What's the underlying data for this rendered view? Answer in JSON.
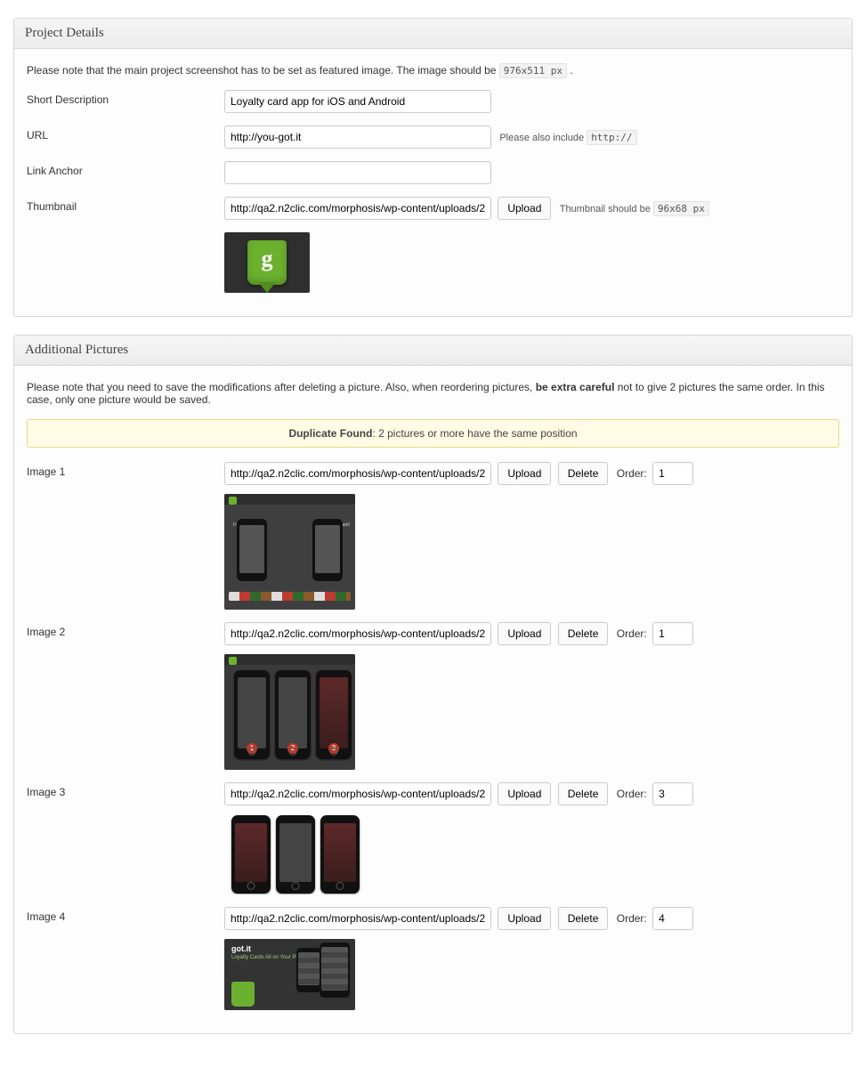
{
  "panels": {
    "project_details": {
      "title": "Project Details",
      "note_pre": "Please note that the main project screenshot has to be set as featured image. The image should be ",
      "note_code": "976x511 px",
      "note_post": " .",
      "fields": {
        "short_desc": {
          "label": "Short Description",
          "value": "Loyalty card app for iOS and Android"
        },
        "url": {
          "label": "URL",
          "value": "http://you-got.it",
          "hint_pre": "Please also include ",
          "hint_code": "http://"
        },
        "link_anchor": {
          "label": "Link Anchor",
          "value": ""
        },
        "thumbnail": {
          "label": "Thumbnail",
          "value": "http://qa2.n2clic.com/morphosis/wp-content/uploads/2",
          "upload": "Upload",
          "hint_pre": "Thumbnail should be ",
          "hint_code": "96x68 px"
        }
      }
    },
    "additional": {
      "title": "Additional Pictures",
      "note_pre": "Please note that you need to save the modifications after deleting a picture. Also, when reordering pictures, ",
      "note_bold": "be extra careful",
      "note_post": " not to give 2 pictures the same order. In this case, only one picture would be saved.",
      "warning_bold": "Duplicate Found",
      "warning_rest": ": 2 pictures or more have the same position",
      "common": {
        "upload": "Upload",
        "delete": "Delete",
        "order_label": "Order:"
      },
      "images": [
        {
          "label": "Image 1",
          "value": "http://qa2.n2clic.com/morphosis/wp-content/uploads/2",
          "order": "1"
        },
        {
          "label": "Image 2",
          "value": "http://qa2.n2clic.com/morphosis/wp-content/uploads/2",
          "order": "1"
        },
        {
          "label": "Image 3",
          "value": "http://qa2.n2clic.com/morphosis/wp-content/uploads/2",
          "order": "3"
        },
        {
          "label": "Image 4",
          "value": "http://qa2.n2clic.com/morphosis/wp-content/uploads/2",
          "order": "4"
        }
      ]
    }
  }
}
